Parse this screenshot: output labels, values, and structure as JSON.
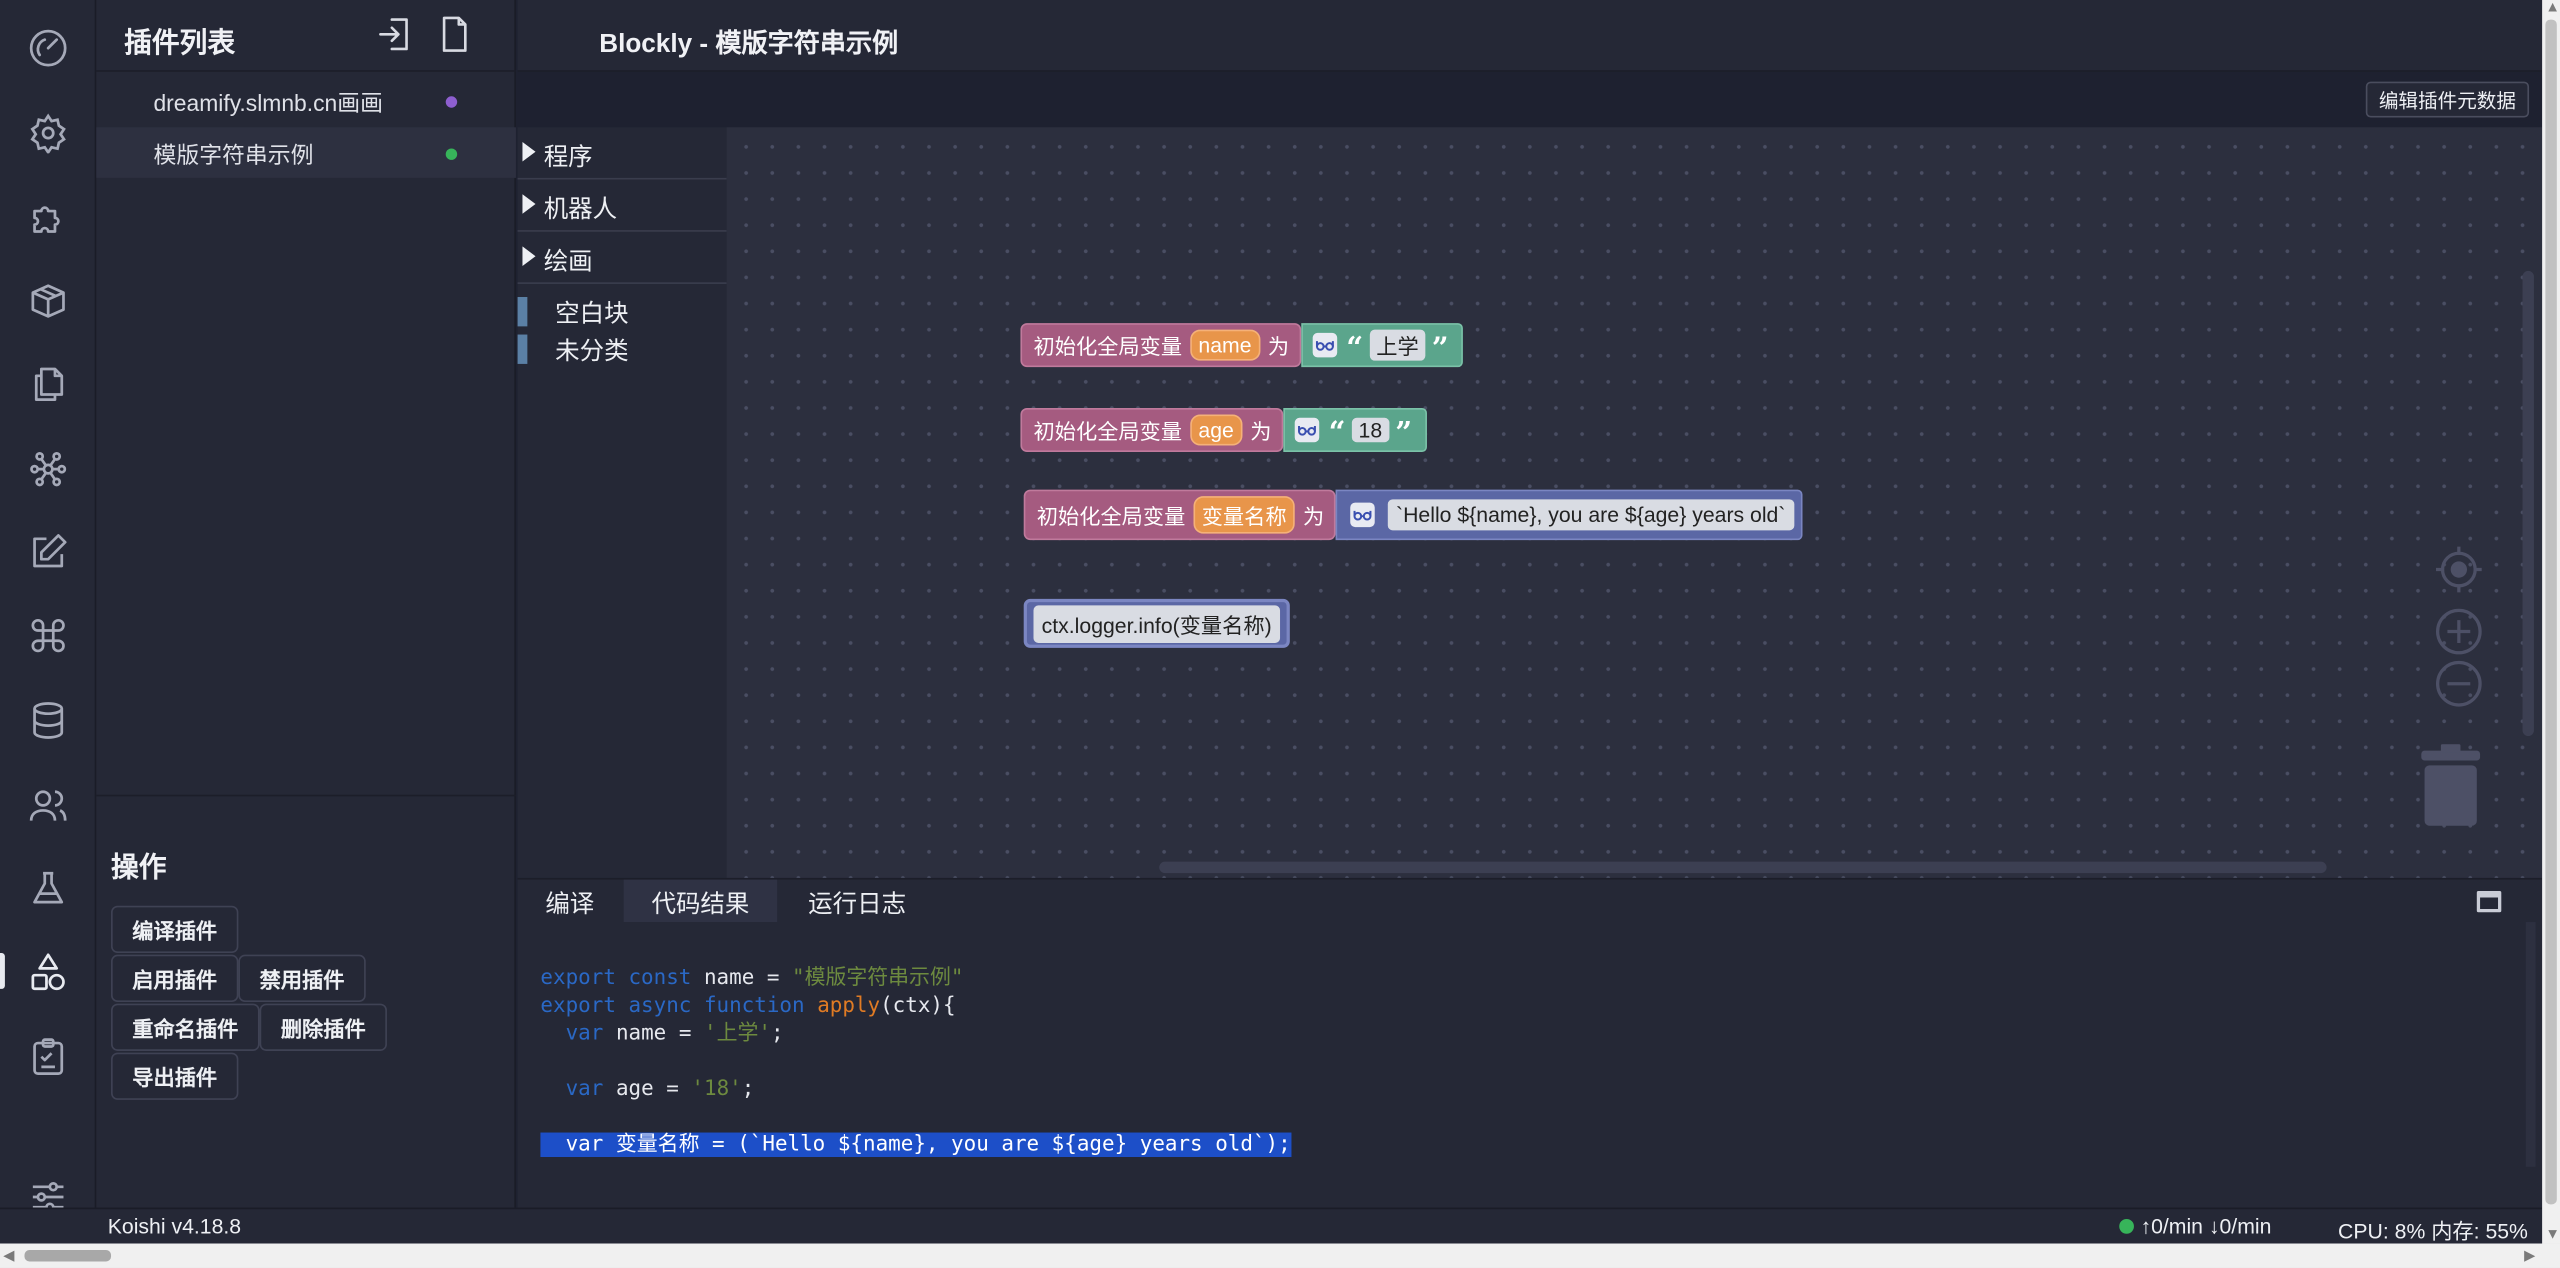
{
  "app": {
    "title": "Blockly - 模版字符串示例",
    "meta_button": "编辑插件元数据"
  },
  "sidebar": {
    "title": "插件列表",
    "plugins": [
      {
        "label": "dreamify.slmnb.cn画画",
        "status_color": "#8e5fd0"
      },
      {
        "label": "模版字符串示例",
        "status_color": "#37b45a"
      }
    ],
    "ops_title": "操作",
    "ops": {
      "compile": "编译插件",
      "enable": "启用插件",
      "disable": "禁用插件",
      "rename": "重命名插件",
      "delete": "删除插件",
      "export": "导出插件"
    }
  },
  "toolbox": {
    "categories": [
      "程序",
      "机器人",
      "绘画"
    ],
    "items": [
      "空白块",
      "未分类"
    ]
  },
  "workspace": {
    "blocks": [
      {
        "prefix": "初始化全局变量",
        "var": "name",
        "suffix": "为",
        "value": "上学"
      },
      {
        "prefix": "初始化全局变量",
        "var": "age",
        "suffix": "为",
        "value": "18"
      },
      {
        "prefix": "初始化全局变量",
        "var": "变量名称",
        "suffix": "为",
        "value": "`Hello ${name}, you are ${age} years old`"
      }
    ],
    "statement": "ctx.logger.info(变量名称)",
    "quote_open": "“",
    "quote_close": "”"
  },
  "panel": {
    "tabs": [
      "编译",
      "代码结果",
      "运行日志"
    ],
    "active_tab": "代码结果",
    "code": {
      "l1_kw": "export const",
      "l1_name": " name = ",
      "l1_str": "\"模版字符串示例\"",
      "l2_kw": "export async function",
      "l2_fn": "apply",
      "l2_rest": "(ctx){",
      "l3_kw": "var",
      "l3_name": " name = ",
      "l3_str": "'上学'",
      "l3_end": ";",
      "l4_kw": "var",
      "l4_name": " age = ",
      "l4_str": "'18'",
      "l4_end": ";",
      "l5": "  var 变量名称 = (`Hello ${name}, you are ${age} years old`);"
    }
  },
  "statusbar": {
    "version": "Koishi v4.18.8",
    "network": "↑0/min ↓0/min",
    "cpu": "CPU: 8% 内存: 55%",
    "status_color": "#37b45a"
  },
  "icons": {
    "activity": [
      "gauge-icon",
      "settings-icon",
      "puzzle-icon",
      "package-icon",
      "files-icon",
      "network-icon",
      "edit-icon",
      "command-icon",
      "database-icon",
      "users-icon",
      "flask-icon",
      "shapes-icon",
      "clipboard-icon",
      "sliders-icon"
    ],
    "header": [
      "login-icon",
      "new-file-icon"
    ],
    "workspace": [
      "recenter-icon",
      "zoom-in-icon",
      "zoom-out-icon",
      "trash-icon",
      "glasses-icon"
    ]
  },
  "colors": {
    "background": "#1e2130",
    "panel": "#252836",
    "variable_block": "#a55b80",
    "string_block": "#5ba58c",
    "template_block": "#5b67a5",
    "selection": "#1d4fc8"
  }
}
